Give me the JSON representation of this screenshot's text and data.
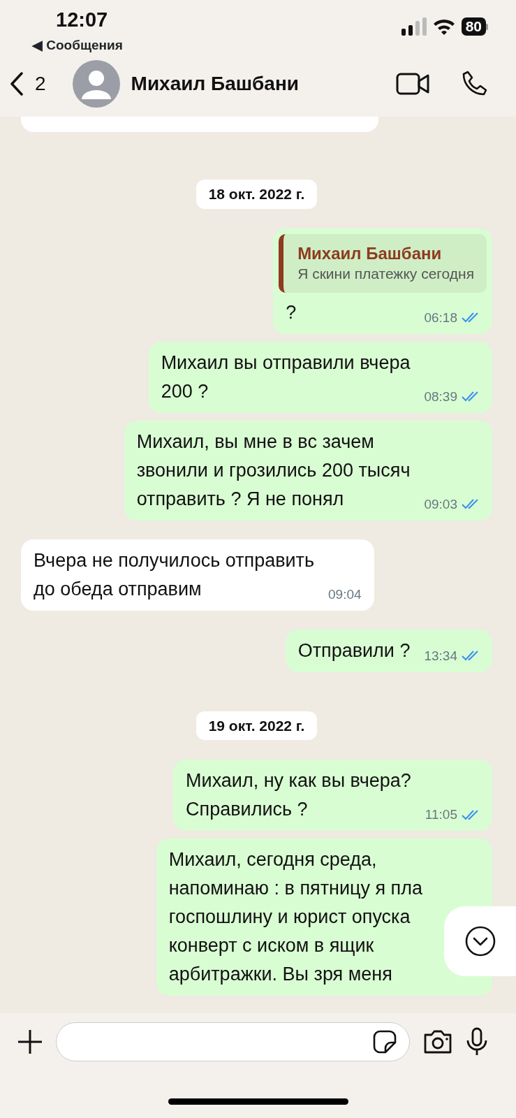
{
  "status_bar": {
    "time": "12:07",
    "back_app": "◀ Сообщения",
    "battery": "80"
  },
  "header": {
    "back_count": "2",
    "contact_name": "Михаил Башбани"
  },
  "chat": [
    {
      "kind": "clipped",
      "outgoing": false
    },
    {
      "kind": "date",
      "text": "18 окт. 2022 г."
    },
    {
      "kind": "message",
      "outgoing": true,
      "quote": {
        "author": "Михаил Башбани",
        "text": "Я скини платежку сегодня"
      },
      "text": "?",
      "time": "06:18",
      "read": true
    },
    {
      "kind": "message",
      "outgoing": true,
      "text": "Михаил вы отправили вчера\n200 ?",
      "time": "08:39",
      "read": true
    },
    {
      "kind": "message",
      "outgoing": true,
      "text": "Михаил, вы мне в вс зачем\nзвонили и грозились 200 тысяч\nотправить ? Я не понял",
      "time": "09:03",
      "read": true
    },
    {
      "kind": "message",
      "outgoing": false,
      "text": "Вчера не получилось отправить\nдо обеда отправим",
      "time": "09:04"
    },
    {
      "kind": "message",
      "outgoing": true,
      "text": "Отправили ?",
      "time": "13:34",
      "read": true
    },
    {
      "kind": "date",
      "text": "19 окт. 2022 г."
    },
    {
      "kind": "message",
      "outgoing": true,
      "text": "Михаил, ну как вы вчера?\nСправились ?",
      "time": "11:05",
      "read": true
    },
    {
      "kind": "message",
      "outgoing": true,
      "text": "Михаил, сегодня среда,\nнапоминаю : в пятницу я пла\nгоспошлину и юрист опуска\nконверт с иском в ящик\nарбитражки. Вы зря меня"
    }
  ]
}
